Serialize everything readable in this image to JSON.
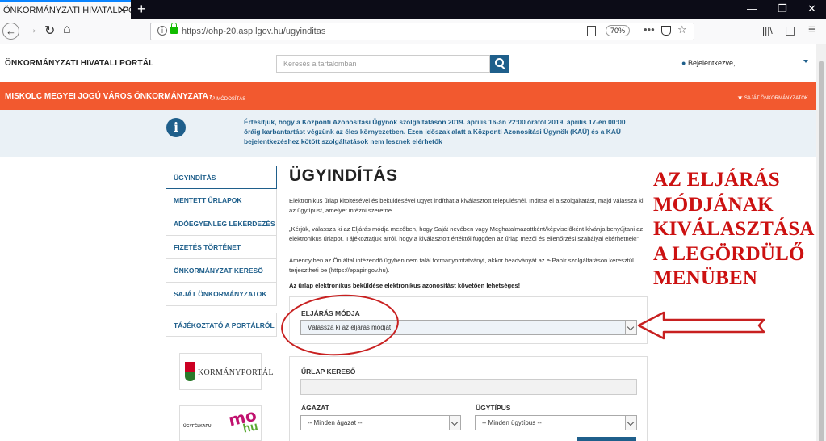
{
  "browser": {
    "tab_title": "ÖNKORMÁNYZATI HIVATALI PORTÁL",
    "tab_close": "✕",
    "new_tab": "+",
    "url": "https://ohp-20.asp.lgov.hu/ugyinditas",
    "zoom": "70%",
    "back_glyph": "←",
    "forward_glyph": "→",
    "reload_glyph": "↻",
    "home_glyph": "⌂",
    "more_glyph": "•••",
    "star_glyph": "☆",
    "library_glyph": "|||\\",
    "sidebar_glyph": "◫",
    "menu_glyph": "≡",
    "min_glyph": "—",
    "max_glyph": "❐",
    "close_glyph": "✕"
  },
  "header": {
    "portal_title": "ÖNKORMÁNYZATI HIVATALI PORTÁL",
    "search_placeholder": "Keresés a tartalomban",
    "user_label": "Bejelentkezve,"
  },
  "municipality": {
    "name": "MISKOLC MEGYEI JOGÚ VÁROS ÖNKORMÁNYZATA",
    "change_label": "MÓDOSÍTÁS",
    "saved_label": "SAJÁT ÖNKORMÁNYZATOK"
  },
  "notice": {
    "text": "Értesítjük, hogy a Központi Azonosítási Ügynök szolgáltatáson 2019. április 16-án 22:00 órától 2019. április 17-én 00:00 óráig karbantartást végzünk az éles környezetben. Ezen időszak alatt a Központi Azonosítási Ügynök (KAÜ) és a KAÜ bejelentkezéshez kötött szolgáltatások nem lesznek elérhetők"
  },
  "sidebar": {
    "items": [
      {
        "label": "ÜGYINDÍTÁS"
      },
      {
        "label": "MENTETT ŰRLAPOK"
      },
      {
        "label": "ADÓEGYENLEG LEKÉRDEZÉS"
      },
      {
        "label": "FIZETÉS TÖRTÉNET"
      },
      {
        "label": "ÖNKORMÁNYZAT KERESŐ"
      },
      {
        "label": "SAJÁT ÖNKORMÁNYZATOK"
      },
      {
        "label": "TÁJÉKOZTATÓ A PORTÁLRÓL"
      }
    ],
    "logo1_text": "KORMÁNYPORTÁL",
    "logo2_text": "ÜGYFÉLKAPU",
    "logo2_mo": "mo",
    "logo2_hu": "hu"
  },
  "main": {
    "title": "ÜGYINDÍTÁS",
    "p1": "Elektronikus űrlap kitöltésével és beküldésével ügyet indíthat a kiválasztott településnél. Indítsa el a szolgáltatást, majd válassza ki az ügytípust, amelyet intézni szeretne.",
    "p2": "„Kérjük, válassza ki az Eljárás módja mezőben, hogy Saját nevében vagy Meghatalmazottként/képviselőként kívánja benyújtani az elektronikus űrlapot. Tájékoztatjuk arról, hogy a kiválasztott értéktől függően az űrlap mezői és ellenőrzési szabályai eltérhetnek!”",
    "p3": "Amennyiben az Ön által intézendő ügyben nem talál formanyomtatványt, akkor beadványát az e-Papír szolgáltatáson keresztül terjesztheti be (https://epapir.gov.hu).",
    "p4": "Az űrlap elektronikus beküldése elektronikus azonosítást követően lehetséges!",
    "procedure_label": "ELJÁRÁS MÓDJA",
    "procedure_value": "Válassza ki az eljárás módját",
    "form_search_label": "ŰRLAP KERESŐ",
    "sector_label": "ÁGAZAT",
    "sector_value": "-- Minden ágazat --",
    "casetype_label": "ÜGYTÍPUS",
    "casetype_value": "-- Minden ügytípus --"
  },
  "annotation": {
    "lines": [
      "AZ ELJÁRÁS",
      "MÓDJÁNAK",
      "KIVÁLASZTÁSA",
      "A LEGÖRDÜLŐ",
      "MENÜBEN"
    ],
    "color": "#cc1111"
  },
  "colors": {
    "accent": "#1f5f8b",
    "municipality_bar": "#f2592f",
    "notice_bg": "#eaf1f6"
  }
}
